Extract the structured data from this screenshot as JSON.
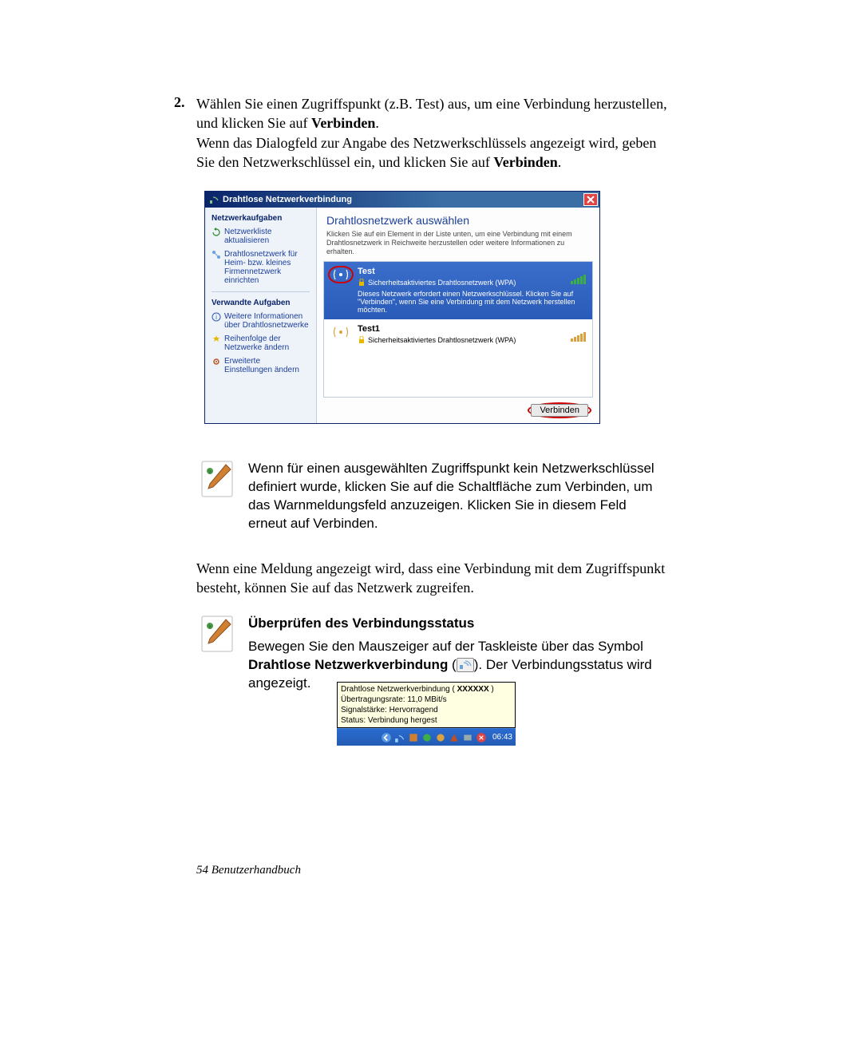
{
  "step": {
    "number": "2.",
    "line1_prefix": "Wählen Sie einen Zugriffspunkt (z.B. Test) aus, um eine Verbindung herzustellen, und klicken Sie auf ",
    "line1_bold": "Verbinden",
    "line1_suffix": ".",
    "line2_prefix": "Wenn das Dialogfeld zur Angabe des Netzwerkschlüssels angezeigt wird, geben Sie den Netzwerkschlüssel ein, und klicken Sie auf ",
    "line2_bold": "Verbinden",
    "line2_suffix": "."
  },
  "dialog": {
    "title": "Drahtlose Netzwerkverbindung",
    "sidebar": {
      "heading1": "Netzwerkaufgaben",
      "link1": "Netzwerkliste aktualisieren",
      "link2": "Drahtlosnetzwerk für Heim- bzw. kleines Firmennetzwerk einrichten",
      "heading2": "Verwandte Aufgaben",
      "link3": "Weitere Informationen über Drahtlosnetzwerke",
      "link4": "Reihenfolge der Netzwerke ändern",
      "link5": "Erweiterte Einstellungen ändern"
    },
    "main": {
      "heading": "Drahtlosnetzwerk auswählen",
      "subtext": "Klicken Sie auf ein Element in der Liste unten, um eine Verbindung mit einem Drahtlosnetzwerk in Reichweite herzustellen oder weitere Informationen zu erhalten.",
      "networks": [
        {
          "name": "Test",
          "security": "Sicherheitsaktiviertes Drahtlosnetzwerk (WPA)",
          "detail": "Dieses Netzwerk erfordert einen Netzwerkschlüssel. Klicken Sie auf \"Verbinden\", wenn Sie eine Verbindung mit dem Netzwerk herstellen möchten.",
          "selected": true,
          "signal_color": "green"
        },
        {
          "name": "Test1",
          "security": "Sicherheitsaktiviertes Drahtlosnetzwerk (WPA)",
          "detail": "",
          "selected": false,
          "signal_color": "orange"
        }
      ],
      "connect_button": "Verbinden"
    }
  },
  "note1": "Wenn für einen ausgewählten Zugriffspunkt kein Netzwerkschlüssel definiert wurde, klicken Sie auf die Schaltfläche zum Verbinden, um das Warnmeldungsfeld anzuzeigen. Klicken Sie in diesem Feld erneut auf Verbinden.",
  "para_after_note": "Wenn eine Meldung angezeigt wird, dass eine Verbindung mit dem Zugriffspunkt besteht, können Sie auf das Netzwerk zugreifen.",
  "status_section": {
    "title": "Überprüfen des Verbindungsstatus",
    "text_prefix": "Bewegen Sie den Mauszeiger auf der Taskleiste über das Symbol ",
    "text_bold": "Drahtlose Netzwerkverbindung",
    "text_middle": " (",
    "text_suffix": "). Der Verbindungsstatus wird angezeigt."
  },
  "tooltip": {
    "line1_prefix": "Drahtlose Netzwerkverbindung ( ",
    "line1_bold": "XXXXXX",
    "line1_suffix": " )",
    "line2": "Übertragungsrate: 11,0 MBit/s",
    "line3": "Signalstärke: Hervorragend",
    "line4": "Status: Verbindung hergest"
  },
  "taskbar": {
    "clock": "06:43"
  },
  "footer": "54  Benutzerhandbuch"
}
